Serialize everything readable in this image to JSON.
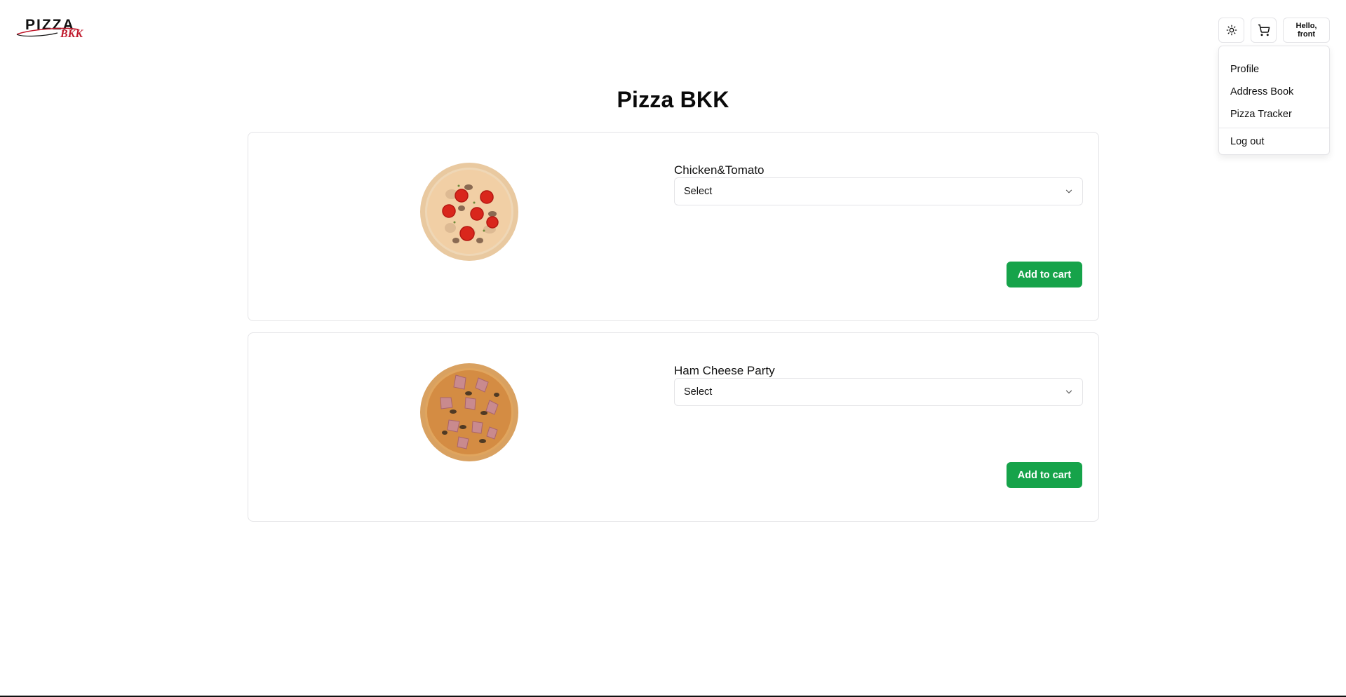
{
  "header": {
    "logo_text_main": "PIZZA",
    "logo_text_accent": "BKK",
    "theme_toggle_icon": "sun-icon",
    "cart_icon": "shopping-cart-icon",
    "user_greeting_line1": "Hello,",
    "user_greeting_line2": "front"
  },
  "user_menu": {
    "items": [
      {
        "label": "Profile"
      },
      {
        "label": "Address Book"
      },
      {
        "label": "Pizza Tracker"
      }
    ],
    "logout_label": "Log out"
  },
  "page": {
    "title": "Pizza BKK"
  },
  "products": [
    {
      "name": "Chicken&Tomato",
      "select_value": "Select",
      "add_label": "Add to cart"
    },
    {
      "name": "Ham Cheese Party",
      "select_value": "Select",
      "add_label": "Add to cart"
    }
  ],
  "colors": {
    "accent": "#16a34a",
    "logo_red": "#c0192c",
    "border": "#e4e4e7"
  }
}
